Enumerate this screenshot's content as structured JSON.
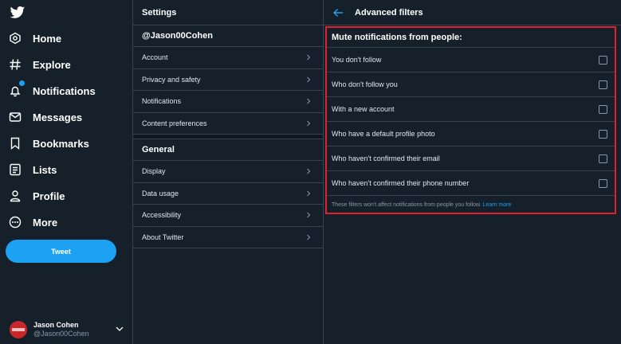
{
  "nav": {
    "items": [
      {
        "label": "Home",
        "icon": "gear-hexagon-icon"
      },
      {
        "label": "Explore",
        "icon": "hashtag-icon"
      },
      {
        "label": "Notifications",
        "icon": "bell-icon"
      },
      {
        "label": "Messages",
        "icon": "envelope-icon"
      },
      {
        "label": "Bookmarks",
        "icon": "bookmark-icon"
      },
      {
        "label": "Lists",
        "icon": "list-icon"
      },
      {
        "label": "Profile",
        "icon": "person-icon"
      },
      {
        "label": "More",
        "icon": "more-circle-icon"
      }
    ],
    "tweet_label": "Tweet",
    "account": {
      "name": "Jason Cohen",
      "handle": "@Jason00Cohen"
    }
  },
  "settings": {
    "title": "Settings",
    "account_section": "@Jason00Cohen",
    "account_items": [
      "Account",
      "Privacy and safety",
      "Notifications",
      "Content preferences"
    ],
    "general_section": "General",
    "general_items": [
      "Display",
      "Data usage",
      "Accessibility",
      "About Twitter"
    ]
  },
  "filters": {
    "title": "Advanced filters",
    "mute_title": "Mute notifications from people:",
    "options": [
      {
        "label": "You don't follow",
        "checked": false
      },
      {
        "label": "Who don't follow you",
        "checked": false
      },
      {
        "label": "With a new account",
        "checked": false
      },
      {
        "label": "Who have a default profile photo",
        "checked": false
      },
      {
        "label": "Who haven't confirmed their email",
        "checked": false
      },
      {
        "label": "Who haven't confirmed their phone number",
        "checked": false
      }
    ],
    "note": "These filters won't affect notifications from people you follow.",
    "learn_more": "Learn more"
  },
  "colors": {
    "background": "#15202b",
    "accent": "#1da1f2",
    "highlight": "#e0212e",
    "border": "#38444d"
  }
}
